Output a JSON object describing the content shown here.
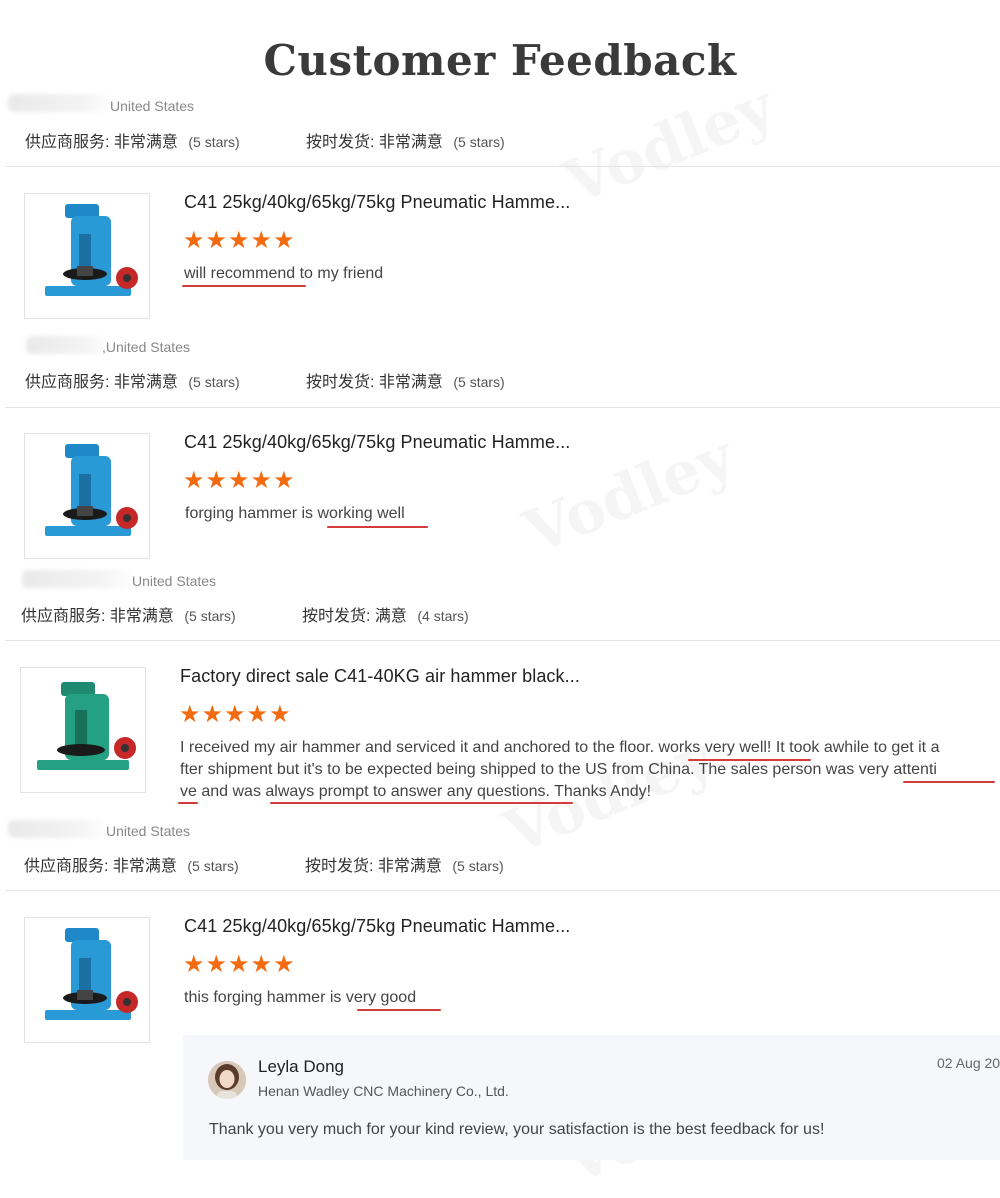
{
  "page": {
    "title": "Customer Feedback"
  },
  "labels": {
    "supplier_service": "供应商服务:",
    "on_time_delivery": "按时发货:",
    "very_satisfied": "非常满意",
    "satisfied": "满意"
  },
  "colors": {
    "star": "#f26b10",
    "underline": "#d43c3c",
    "reply_bg": "#f5f7fb"
  },
  "reviews": [
    {
      "country": "United States",
      "supplier_service_value": "非常满意",
      "supplier_service_stars": "(5 stars)",
      "delivery_value": "非常满意",
      "delivery_stars": "(5 stars)"
    },
    {
      "product_title": "C41 25kg/40kg/65kg/75kg Pneumatic Hamme...",
      "product_image": "blue-air-hammer-icon",
      "rating": 5,
      "stars_glyphs": "★★★★★",
      "review_text": "will recommend to my friend",
      "country": ",United States",
      "supplier_service_value": "非常满意",
      "supplier_service_stars": "(5 stars)",
      "delivery_value": "非常满意",
      "delivery_stars": "(5 stars)"
    },
    {
      "product_title": "C41 25kg/40kg/65kg/75kg Pneumatic Hamme...",
      "product_image": "blue-air-hammer-icon",
      "rating": 5,
      "stars_glyphs": "★★★★★",
      "review_text": "forging hammer is working well",
      "country": "United States",
      "supplier_service_value": "非常满意",
      "supplier_service_stars": "(5 stars)",
      "delivery_value": "满意",
      "delivery_stars": "(4 stars)"
    },
    {
      "product_title": "Factory direct sale C41-40KG air hammer black...",
      "product_image": "green-air-hammer-icon",
      "rating": 5,
      "stars_glyphs": "★★★★★",
      "review_lines": [
        "I received my air hammer and serviced it and anchored to the floor. works very well! It took awhile to get it a",
        "fter shipment but it's to be expected being shipped to the US from China. The sales person was very attenti",
        "ve and was always prompt to answer any questions. Thanks Andy!"
      ],
      "country": "United States",
      "supplier_service_value": "非常满意",
      "supplier_service_stars": "(5 stars)",
      "delivery_value": "非常满意",
      "delivery_stars": "(5 stars)"
    },
    {
      "product_title": "C41 25kg/40kg/65kg/75kg Pneumatic Hamme...",
      "product_image": "blue-air-hammer-icon",
      "rating": 5,
      "stars_glyphs": "★★★★★",
      "review_text": "this forging hammer is very good"
    }
  ],
  "reply": {
    "name": "Leyla Dong",
    "company": "Henan Wadley CNC Machinery Co., Ltd.",
    "date": "02 Aug 20",
    "message": "Thank you very much for your kind review, your satisfaction is the best feedback for us!"
  },
  "watermark": "Vodley"
}
